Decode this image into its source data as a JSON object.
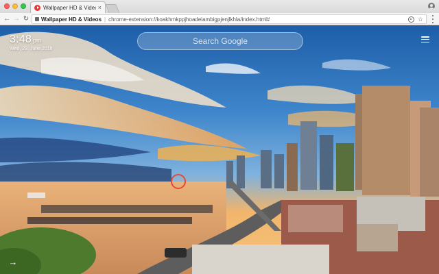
{
  "browser": {
    "tab": {
      "title": "Wallpaper HD & Videos",
      "favicon": "youtube-play-icon",
      "close_glyph": "×"
    },
    "nav": {
      "back": "←",
      "forward": "→",
      "reload": "↻"
    },
    "omnibox": {
      "app_name": "Wallpaper HD & Videos",
      "separator": "|",
      "url": "chrome-extension://koakhmkppjhoadeiambigpjenjlkhla/index.html#"
    },
    "icons": [
      "extension-icon",
      "bookmark-star-icon",
      "profile-icon",
      "menu-dots-icon"
    ],
    "star_glyph": "☆"
  },
  "page": {
    "clock": {
      "time": "3:48",
      "ampm": "pm",
      "date": "Wed, 29. June 2018"
    },
    "search": {
      "placeholder": "Search Google"
    },
    "arrow_glyph": "→",
    "colors": {
      "sky_top": "#1f5fa8",
      "sunset": "#f6b24a",
      "water": "#e9a86a"
    }
  }
}
